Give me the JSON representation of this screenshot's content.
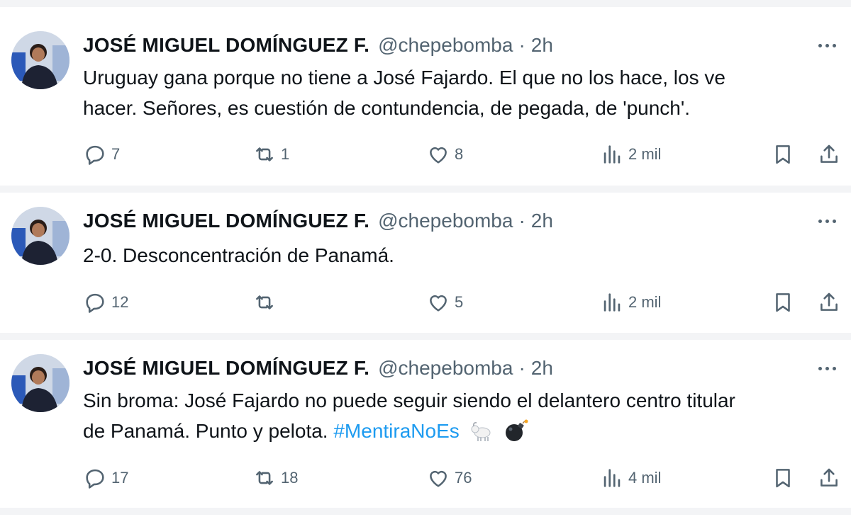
{
  "tweets": [
    {
      "author_name": "JOSÉ MIGUEL DOMÍNGUEZ F.",
      "handle": "@chepebomba",
      "separator": "·",
      "time": "2h",
      "text_lines": [
        "Uruguay gana porque no tiene a José Fajardo. El que no los hace, los ve",
        "hacer. Señores, es cuestión de contundencia, de pegada, de 'punch'."
      ],
      "reply_count": "7",
      "retweet_count": "1",
      "like_count": "8",
      "view_count": "2 mil"
    },
    {
      "author_name": "JOSÉ MIGUEL DOMÍNGUEZ F.",
      "handle": "@chepebomba",
      "separator": "·",
      "time": "2h",
      "text_lines": [
        "2-0. Desconcentración de Panamá."
      ],
      "reply_count": "12",
      "retweet_count": "",
      "like_count": "5",
      "view_count": "2 mil"
    },
    {
      "author_name": "JOSÉ MIGUEL DOMÍNGUEZ F.",
      "handle": "@chepebomba",
      "separator": "·",
      "time": "2h",
      "text_line_1": "Sin broma: José Fajardo no puede seguir siendo el delantero centro titular",
      "text_line_2": "de Panamá. Punto y pelota.",
      "hashtag": "#MentiraNoEs",
      "emojis": [
        "goat-emoji",
        "bomb-emoji"
      ],
      "reply_count": "17",
      "retweet_count": "18",
      "like_count": "76",
      "view_count": "4 mil"
    }
  ],
  "icons": {
    "reply": "reply-icon",
    "retweet": "retweet-icon",
    "like": "heart-icon",
    "views": "views-icon",
    "bookmark": "bookmark-icon",
    "share": "share-icon",
    "more": "more-options-icon"
  },
  "colors": {
    "text": "#0f1419",
    "secondary": "#536471",
    "hashtag": "#1d9bf0",
    "divider": "#f3f4f6"
  }
}
